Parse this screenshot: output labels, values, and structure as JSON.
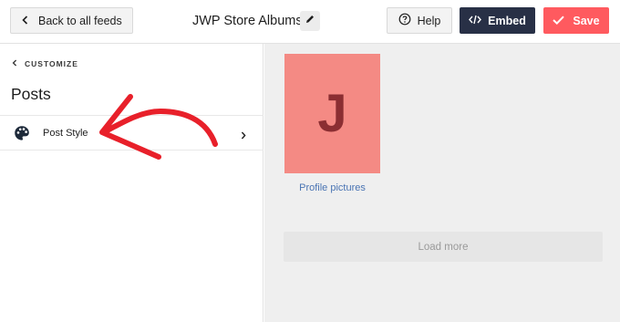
{
  "header": {
    "back_label": "Back to all feeds",
    "feed_title": "JWP Store Albums",
    "help_label": "Help",
    "embed_label": "Embed",
    "save_label": "Save"
  },
  "sidebar": {
    "breadcrumb": "CUSTOMIZE",
    "heading": "Posts",
    "items": [
      {
        "label": "Post Style",
        "icon": "palette-icon"
      }
    ]
  },
  "preview": {
    "profile_initial": "J",
    "profile_caption": "Profile pictures",
    "load_more_label": "Load more"
  },
  "colors": {
    "embed_bg": "#283046",
    "save_bg": "#ff5a5f",
    "tile_bg": "#f48a84",
    "initial_color": "#8b2e32",
    "caption_link": "#4a74b3",
    "annotation_arrow": "#e8202a"
  }
}
